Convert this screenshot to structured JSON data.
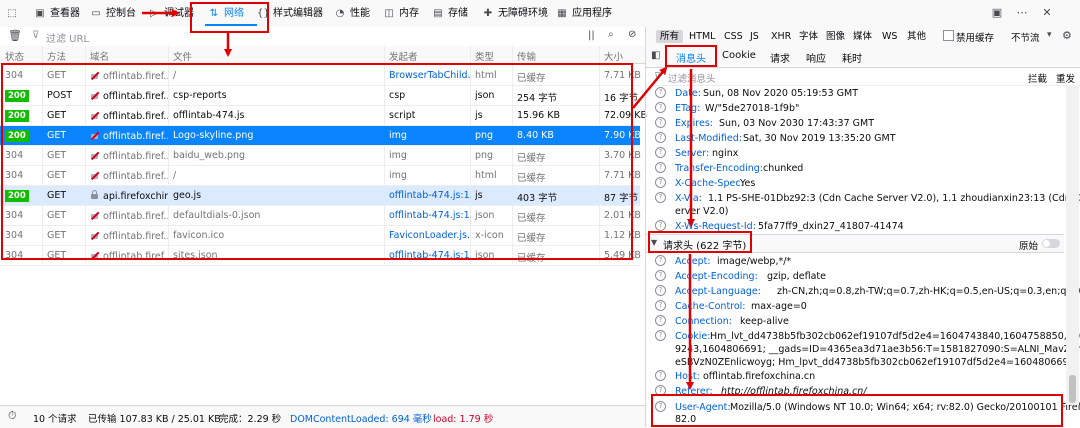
{
  "toolbar": {
    "items": [
      {
        "label": "查看器",
        "icon": "inspector-icon"
      },
      {
        "label": "控制台",
        "icon": "console-icon"
      },
      {
        "label": "调试器",
        "icon": "debugger-icon"
      },
      {
        "label": "网络",
        "icon": "network-icon"
      },
      {
        "label": "样式编辑器",
        "icon": "style-editor-icon"
      },
      {
        "label": "性能",
        "icon": "performance-icon"
      },
      {
        "label": "内存",
        "icon": "memory-icon"
      },
      {
        "label": "存储",
        "icon": "storage-icon"
      },
      {
        "label": "无障碍环境",
        "icon": "accessibility-icon"
      },
      {
        "label": "应用程序",
        "icon": "application-icon"
      }
    ],
    "active": "网络"
  },
  "filter": {
    "placeholder": "过滤 URL"
  },
  "type_filters": [
    "所有",
    "HTML",
    "CSS",
    "JS",
    "XHR",
    "字体",
    "图像",
    "媒体",
    "WS",
    "其他"
  ],
  "disable_cache_label": "禁用缓存",
  "throttle_label": "不节流",
  "columns": [
    "状态",
    "方法",
    "域名",
    "文件",
    "发起者",
    "类型",
    "传输",
    "大小"
  ],
  "requests": [
    {
      "status": "304",
      "method": "GET",
      "domain": "offlintab.firef...",
      "file": "/",
      "initiator": "BrowserTabChild...",
      "type": "html",
      "transfer": "已缓存",
      "size": "7.71 KB"
    },
    {
      "status": "200",
      "method": "POST",
      "domain": "offlintab.firef...",
      "file": "csp-reports",
      "initiator": "csp",
      "type": "json",
      "transfer": "254 字节",
      "size": "16 字节"
    },
    {
      "status": "200",
      "method": "GET",
      "domain": "offlintab.firef...",
      "file": "offlintab-474.js",
      "initiator": "script",
      "type": "js",
      "transfer": "15.96 KB",
      "size": "72.09 KB"
    },
    {
      "status": "200",
      "method": "GET",
      "domain": "offlintab.firef...",
      "file": "Logo-skyline.png",
      "initiator": "img",
      "type": "png",
      "transfer": "8.40 KB",
      "size": "7.90 KB"
    },
    {
      "status": "304",
      "method": "GET",
      "domain": "offlintab.firef...",
      "file": "baidu_web.png",
      "initiator": "img",
      "type": "png",
      "transfer": "已缓存",
      "size": "3.70 KB"
    },
    {
      "status": "304",
      "method": "GET",
      "domain": "offlintab.firef...",
      "file": "/",
      "initiator": "img",
      "type": "html",
      "transfer": "已缓存",
      "size": "7.71 KB"
    },
    {
      "status": "200",
      "method": "GET",
      "domain": "api.firefoxchina...",
      "file": "geo.js",
      "initiator": "offlintab-474.js:1...",
      "type": "js",
      "transfer": "403 字节",
      "size": "87 字节"
    },
    {
      "status": "304",
      "method": "GET",
      "domain": "offlintab.firef...",
      "file": "defaultdials-0.json",
      "initiator": "offlintab-474.js:1...",
      "type": "json",
      "transfer": "已缓存",
      "size": "2.01 KB"
    },
    {
      "status": "304",
      "method": "GET",
      "domain": "offlintab.firef...",
      "file": "favicon.ico",
      "initiator": "FaviconLoader.js...",
      "type": "x-icon",
      "transfer": "已缓存",
      "size": "1.12 KB"
    },
    {
      "status": "304",
      "method": "GET",
      "domain": "offlintab.firef...",
      "file": "sites.json",
      "initiator": "offlintab-474.js:1...",
      "type": "json",
      "transfer": "已缓存",
      "size": "5.49 KB"
    }
  ],
  "status_bar": {
    "requests": "10 个请求",
    "transferred": "已传输 107.83 KB / 25.01 KB",
    "finish": "完成：2.29 秒",
    "dcl": "DOMContentLoaded: 694 毫秒",
    "load": "load: 1.79 秒"
  },
  "detail_tabs": [
    "消息头",
    "Cookie",
    "请求",
    "响应",
    "耗时"
  ],
  "detail_filter": {
    "placeholder": "过滤消息头",
    "block_label": "拦截",
    "resend_label": "重发"
  },
  "response_headers": [
    {
      "key": "Date:",
      "value": "Sun, 08 Nov 2020 05:19:53 GMT"
    },
    {
      "key": "ETag:",
      "value": "W/\"5de27018-1f9b\""
    },
    {
      "key": "Expires:",
      "value": "Sun, 03 Nov 2030 17:43:37 GMT"
    },
    {
      "key": "Last-Modified:",
      "value": "Sat, 30 Nov 2019 13:35:20 GMT"
    },
    {
      "key": "Server:",
      "value": "nginx"
    },
    {
      "key": "Transfer-Encoding:",
      "value": "chunked"
    },
    {
      "key": "X-Cache-Spec:",
      "value": "Yes"
    },
    {
      "key": "X-Via:",
      "value": "1.1 PS-SHE-01Dbz92:3 (Cdn Cache Server V2.0), 1.1 zhoudianxin23:13 (Cdn Cache S",
      "value2": "erver V2.0)"
    },
    {
      "key": "X-Ws-Request-Id:",
      "value": "5fa77ff9_dxin27_41807-41474"
    }
  ],
  "request_section": {
    "title": "请求头 (622 字节)",
    "raw_label": "原始"
  },
  "request_headers": [
    {
      "key": "Accept:",
      "value": "image/webp,*/*"
    },
    {
      "key": "Accept-Encoding:",
      "value": "gzip, deflate"
    },
    {
      "key": "Accept-Language:",
      "value": "zh-CN,zh;q=0.8,zh-TW;q=0.7,zh-HK;q=0.5,en-US;q=0.3,en;q=0.2"
    },
    {
      "key": "Cache-Control:",
      "value": "max-age=0"
    },
    {
      "key": "Connection:",
      "value": "keep-alive"
    },
    {
      "key": "Cookie:",
      "value": "Hm_lvt_dd4738b5fb302cb062ef19107df5d2e4=1604743840,1604758850,160476",
      "value2": "9243,1604806691; __gads=ID=4365ea3d71ae3b56:T=1581827090:S=ALNI_MavZ1mubc4R",
      "value3": "eSBVzN0ZEnlicwoyg; Hm_lpvt_dd4738b5fb302cb062ef19107df5d2e4=1604806691"
    },
    {
      "key": "Host:",
      "value": "offlintab.firefoxchina.cn"
    },
    {
      "key": "Referer:",
      "value": "http://offlintab.firefoxchina.cn/"
    },
    {
      "key": "User-Agent:",
      "value": "Mozilla/5.0 (Windows NT 10.0; Win64; x64; rv:82.0) Gecko/20100101 Firefox/",
      "value2": "82.0"
    }
  ],
  "colors": {
    "accent": "#0a84ff",
    "status_ok": "#12bc00",
    "annotation": "#e00000"
  }
}
